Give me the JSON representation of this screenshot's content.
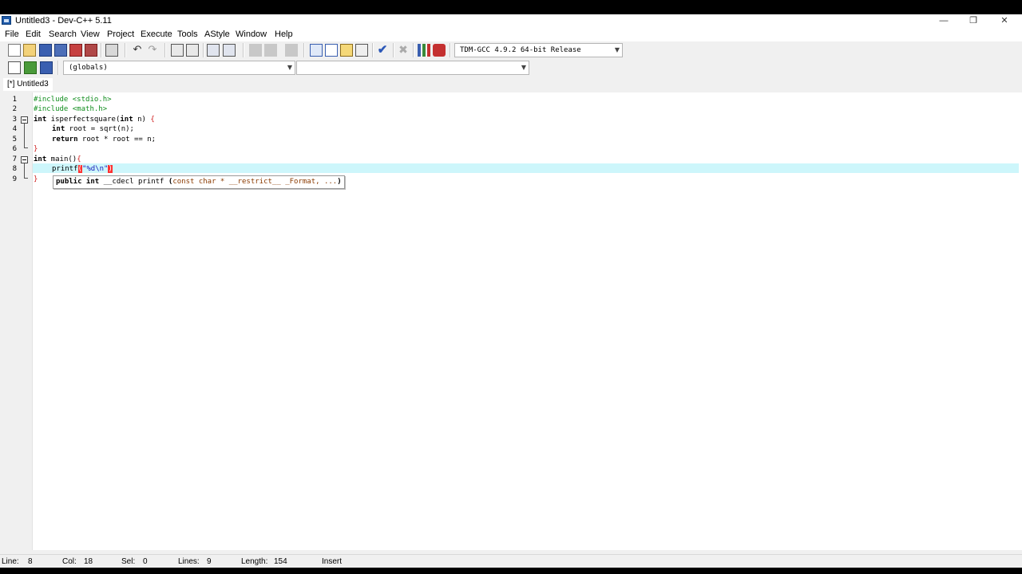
{
  "window": {
    "title": "Untitled3 - Dev-C++ 5.11"
  },
  "menu": [
    "File",
    "Edit",
    "Search",
    "View",
    "Project",
    "Execute",
    "Tools",
    "AStyle",
    "Window",
    "Help"
  ],
  "toolbar": {
    "compiler": "TDM-GCC 4.9.2 64-bit Release"
  },
  "toolbar2": {
    "scope": "(globals)",
    "member": ""
  },
  "tabs": [
    {
      "label": "[*] Untitled3"
    }
  ],
  "editor": {
    "line_numbers": [
      "1",
      "2",
      "3",
      "4",
      "5",
      "6",
      "7",
      "8",
      "9"
    ],
    "lines": {
      "l1": "#include <stdio.h>",
      "l2": "#include <math.h>",
      "l3_kw": "int",
      "l3_name": " isperfectsquare(",
      "l3_kw2": "int",
      "l3_rest": " n) ",
      "l3_brace": "{",
      "l4_kw": "int",
      "l4_rest": " root = sqrt(n);",
      "l5_kw": "return",
      "l5_rest": " root * root == n;",
      "l6": "}",
      "l7_kw": "int",
      "l7_rest": " main()",
      "l7_brace": "{",
      "l8_fn": "printf",
      "l8_open": "(",
      "l8_str": "\"%d\\n\"",
      "l8_close": ")",
      "l9": "}"
    },
    "hint": {
      "public": "public int",
      "cdecl": " __cdecl printf ",
      "open": "(",
      "args": "const char * __restrict__ _Format, ...",
      "close": ")"
    }
  },
  "status": {
    "line_label": "Line:",
    "line_value": "8",
    "col_label": "Col:",
    "col_value": "18",
    "sel_label": "Sel:",
    "sel_value": "0",
    "lines_label": "Lines:",
    "lines_value": "9",
    "length_label": "Length:",
    "length_value": "154",
    "mode": "Insert"
  }
}
